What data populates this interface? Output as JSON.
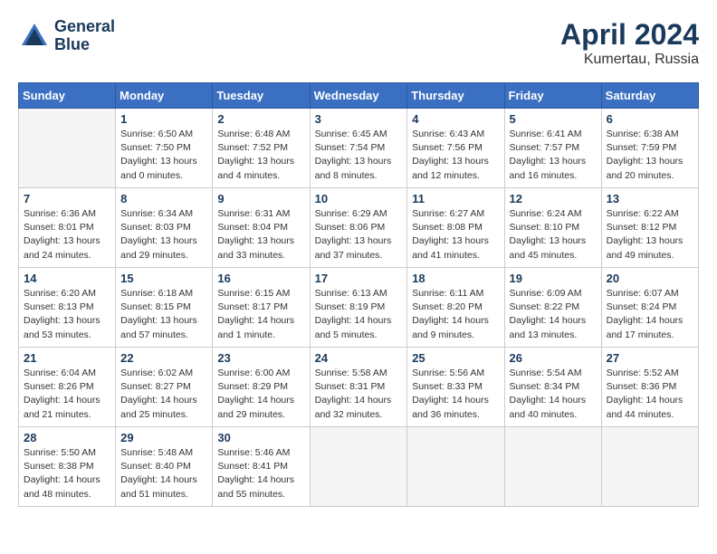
{
  "logo": {
    "line1": "General",
    "line2": "Blue"
  },
  "title": "April 2024",
  "location": "Kumertau, Russia",
  "days_header": [
    "Sunday",
    "Monday",
    "Tuesday",
    "Wednesday",
    "Thursday",
    "Friday",
    "Saturday"
  ],
  "weeks": [
    [
      {
        "num": "",
        "info": ""
      },
      {
        "num": "1",
        "info": "Sunrise: 6:50 AM\nSunset: 7:50 PM\nDaylight: 13 hours\nand 0 minutes."
      },
      {
        "num": "2",
        "info": "Sunrise: 6:48 AM\nSunset: 7:52 PM\nDaylight: 13 hours\nand 4 minutes."
      },
      {
        "num": "3",
        "info": "Sunrise: 6:45 AM\nSunset: 7:54 PM\nDaylight: 13 hours\nand 8 minutes."
      },
      {
        "num": "4",
        "info": "Sunrise: 6:43 AM\nSunset: 7:56 PM\nDaylight: 13 hours\nand 12 minutes."
      },
      {
        "num": "5",
        "info": "Sunrise: 6:41 AM\nSunset: 7:57 PM\nDaylight: 13 hours\nand 16 minutes."
      },
      {
        "num": "6",
        "info": "Sunrise: 6:38 AM\nSunset: 7:59 PM\nDaylight: 13 hours\nand 20 minutes."
      }
    ],
    [
      {
        "num": "7",
        "info": "Sunrise: 6:36 AM\nSunset: 8:01 PM\nDaylight: 13 hours\nand 24 minutes."
      },
      {
        "num": "8",
        "info": "Sunrise: 6:34 AM\nSunset: 8:03 PM\nDaylight: 13 hours\nand 29 minutes."
      },
      {
        "num": "9",
        "info": "Sunrise: 6:31 AM\nSunset: 8:04 PM\nDaylight: 13 hours\nand 33 minutes."
      },
      {
        "num": "10",
        "info": "Sunrise: 6:29 AM\nSunset: 8:06 PM\nDaylight: 13 hours\nand 37 minutes."
      },
      {
        "num": "11",
        "info": "Sunrise: 6:27 AM\nSunset: 8:08 PM\nDaylight: 13 hours\nand 41 minutes."
      },
      {
        "num": "12",
        "info": "Sunrise: 6:24 AM\nSunset: 8:10 PM\nDaylight: 13 hours\nand 45 minutes."
      },
      {
        "num": "13",
        "info": "Sunrise: 6:22 AM\nSunset: 8:12 PM\nDaylight: 13 hours\nand 49 minutes."
      }
    ],
    [
      {
        "num": "14",
        "info": "Sunrise: 6:20 AM\nSunset: 8:13 PM\nDaylight: 13 hours\nand 53 minutes."
      },
      {
        "num": "15",
        "info": "Sunrise: 6:18 AM\nSunset: 8:15 PM\nDaylight: 13 hours\nand 57 minutes."
      },
      {
        "num": "16",
        "info": "Sunrise: 6:15 AM\nSunset: 8:17 PM\nDaylight: 14 hours\nand 1 minute."
      },
      {
        "num": "17",
        "info": "Sunrise: 6:13 AM\nSunset: 8:19 PM\nDaylight: 14 hours\nand 5 minutes."
      },
      {
        "num": "18",
        "info": "Sunrise: 6:11 AM\nSunset: 8:20 PM\nDaylight: 14 hours\nand 9 minutes."
      },
      {
        "num": "19",
        "info": "Sunrise: 6:09 AM\nSunset: 8:22 PM\nDaylight: 14 hours\nand 13 minutes."
      },
      {
        "num": "20",
        "info": "Sunrise: 6:07 AM\nSunset: 8:24 PM\nDaylight: 14 hours\nand 17 minutes."
      }
    ],
    [
      {
        "num": "21",
        "info": "Sunrise: 6:04 AM\nSunset: 8:26 PM\nDaylight: 14 hours\nand 21 minutes."
      },
      {
        "num": "22",
        "info": "Sunrise: 6:02 AM\nSunset: 8:27 PM\nDaylight: 14 hours\nand 25 minutes."
      },
      {
        "num": "23",
        "info": "Sunrise: 6:00 AM\nSunset: 8:29 PM\nDaylight: 14 hours\nand 29 minutes."
      },
      {
        "num": "24",
        "info": "Sunrise: 5:58 AM\nSunset: 8:31 PM\nDaylight: 14 hours\nand 32 minutes."
      },
      {
        "num": "25",
        "info": "Sunrise: 5:56 AM\nSunset: 8:33 PM\nDaylight: 14 hours\nand 36 minutes."
      },
      {
        "num": "26",
        "info": "Sunrise: 5:54 AM\nSunset: 8:34 PM\nDaylight: 14 hours\nand 40 minutes."
      },
      {
        "num": "27",
        "info": "Sunrise: 5:52 AM\nSunset: 8:36 PM\nDaylight: 14 hours\nand 44 minutes."
      }
    ],
    [
      {
        "num": "28",
        "info": "Sunrise: 5:50 AM\nSunset: 8:38 PM\nDaylight: 14 hours\nand 48 minutes."
      },
      {
        "num": "29",
        "info": "Sunrise: 5:48 AM\nSunset: 8:40 PM\nDaylight: 14 hours\nand 51 minutes."
      },
      {
        "num": "30",
        "info": "Sunrise: 5:46 AM\nSunset: 8:41 PM\nDaylight: 14 hours\nand 55 minutes."
      },
      {
        "num": "",
        "info": ""
      },
      {
        "num": "",
        "info": ""
      },
      {
        "num": "",
        "info": ""
      },
      {
        "num": "",
        "info": ""
      }
    ]
  ]
}
